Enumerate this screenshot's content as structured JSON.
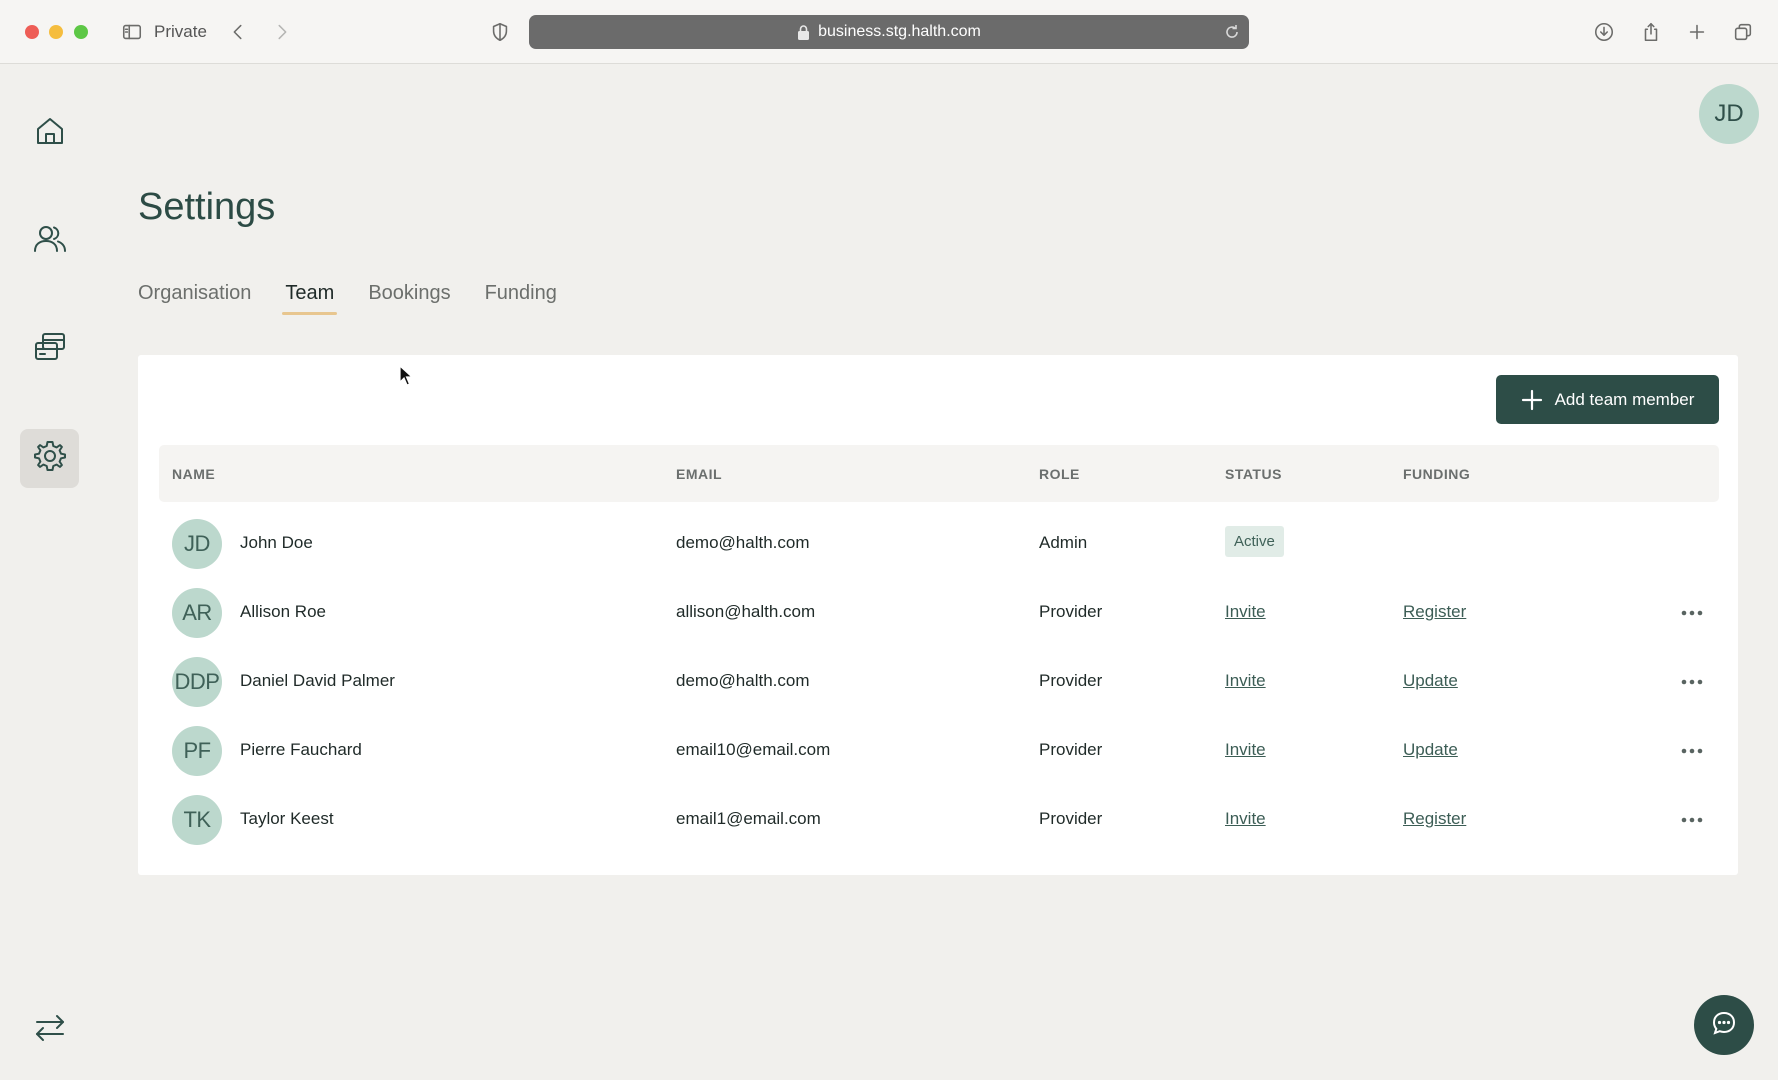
{
  "browser": {
    "private_label": "Private",
    "url": "business.stg.halth.com"
  },
  "sidebar": {
    "items": [
      {
        "icon": "home-icon",
        "active": false
      },
      {
        "icon": "users-icon",
        "active": false
      },
      {
        "icon": "cards-icon",
        "active": false
      },
      {
        "icon": "gear-icon",
        "active": true
      }
    ],
    "bottom_icon": "swap-arrows-icon"
  },
  "user": {
    "initials": "JD"
  },
  "page": {
    "title": "Settings",
    "tabs": [
      {
        "label": "Organisation",
        "active": false
      },
      {
        "label": "Team",
        "active": true
      },
      {
        "label": "Bookings",
        "active": false
      },
      {
        "label": "Funding",
        "active": false
      }
    ]
  },
  "team": {
    "add_button_label": "Add team member",
    "columns": [
      "NAME",
      "EMAIL",
      "ROLE",
      "STATUS",
      "FUNDING"
    ],
    "rows": [
      {
        "initials": "JD",
        "name": "John Doe",
        "email": "demo@halth.com",
        "role": "Admin",
        "status": "Active",
        "funding": ""
      },
      {
        "initials": "AR",
        "name": "Allison Roe",
        "email": "allison@halth.com",
        "role": "Provider",
        "status": "Invite",
        "funding": "Register"
      },
      {
        "initials": "DDP",
        "name": "Daniel David Palmer",
        "email": "demo@halth.com",
        "role": "Provider",
        "status": "Invite",
        "funding": "Update"
      },
      {
        "initials": "PF",
        "name": "Pierre Fauchard",
        "email": "email10@email.com",
        "role": "Provider",
        "status": "Invite",
        "funding": "Update"
      },
      {
        "initials": "TK",
        "name": "Taylor Keest",
        "email": "email1@email.com",
        "role": "Provider",
        "status": "Invite",
        "funding": "Register"
      }
    ]
  },
  "colors": {
    "brand_dark": "#2d4d47",
    "avatar_bg": "#bcd8cd",
    "tab_underline": "#e8c68f",
    "background": "#f1f0ed"
  }
}
